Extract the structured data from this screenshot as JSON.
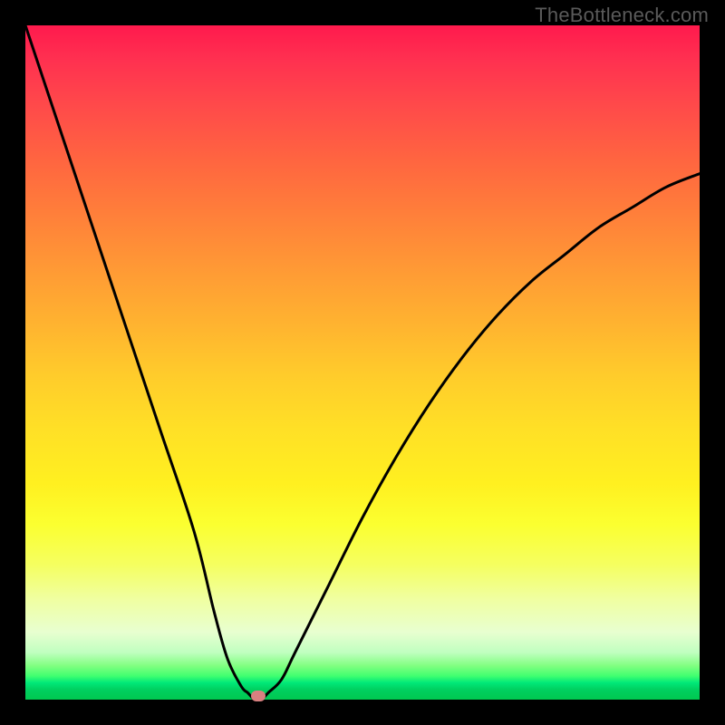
{
  "watermark": "TheBottleneck.com",
  "chart_data": {
    "type": "line",
    "title": "",
    "xlabel": "",
    "ylabel": "",
    "xlim": [
      0,
      100
    ],
    "ylim": [
      0,
      100
    ],
    "series": [
      {
        "name": "bottleneck-curve",
        "x": [
          0,
          5,
          10,
          15,
          20,
          25,
          28,
          30,
          32,
          33,
          34,
          35,
          36,
          38,
          40,
          45,
          50,
          55,
          60,
          65,
          70,
          75,
          80,
          85,
          90,
          95,
          100
        ],
        "values": [
          100,
          85,
          70,
          55,
          40,
          25,
          13,
          6,
          2,
          1,
          0,
          0,
          1,
          3,
          7,
          17,
          27,
          36,
          44,
          51,
          57,
          62,
          66,
          70,
          73,
          76,
          78
        ]
      }
    ],
    "marker": {
      "x": 34.5,
      "y": 0
    },
    "gradient": {
      "top": "#ff1a4d",
      "mid": "#ffee20",
      "bottom": "#00c850"
    }
  }
}
